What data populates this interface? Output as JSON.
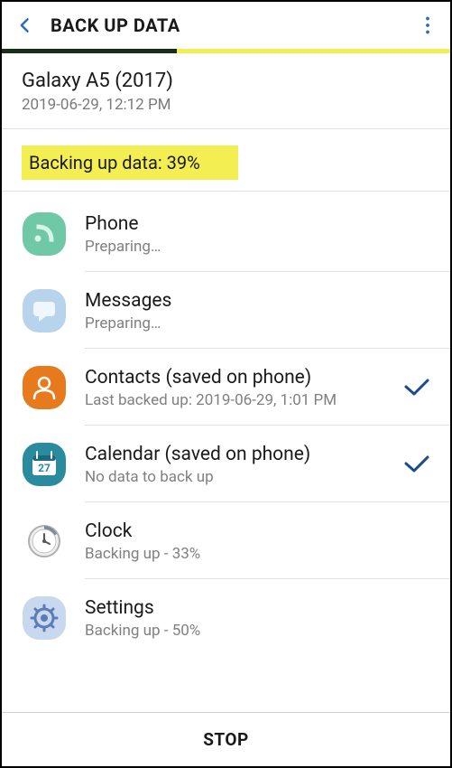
{
  "header": {
    "title": "BACK UP DATA"
  },
  "progress": {
    "percent": 39
  },
  "device": {
    "name": "Galaxy A5 (2017)",
    "timestamp": "2019-06-29, 12:12 PM"
  },
  "status": {
    "text": "Backing up data: 39%"
  },
  "items": [
    {
      "title": "Phone",
      "sub": "Preparing…",
      "icon": "phone",
      "done": false
    },
    {
      "title": "Messages",
      "sub": "Preparing…",
      "icon": "messages",
      "done": false
    },
    {
      "title": "Contacts (saved on phone)",
      "sub": "Last backed up: 2019-06-29, 1:01 PM",
      "icon": "contacts",
      "done": true
    },
    {
      "title": "Calendar (saved on phone)",
      "sub": "No data to back up",
      "icon": "calendar",
      "done": true
    },
    {
      "title": "Clock",
      "sub": "Backing up - 33%",
      "icon": "clock",
      "done": false
    },
    {
      "title": "Settings",
      "sub": "Backing up - 50%",
      "icon": "settings",
      "done": false
    }
  ],
  "footer": {
    "stop": "STOP"
  }
}
